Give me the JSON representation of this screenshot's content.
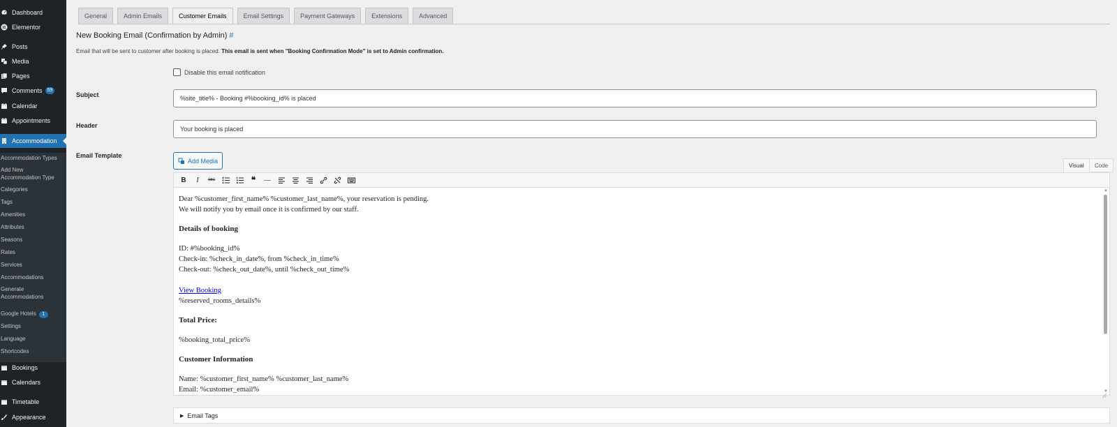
{
  "sidebar": {
    "top_items": [
      {
        "label": "Dashboard",
        "icon": "dashboard-icon"
      },
      {
        "label": "Elementor",
        "icon": "elementor-icon"
      },
      {
        "label": "Posts",
        "icon": "pin-icon"
      },
      {
        "label": "Media",
        "icon": "media-icon"
      },
      {
        "label": "Pages",
        "icon": "pages-icon"
      },
      {
        "label": "Comments",
        "icon": "comment-icon",
        "badge": "59"
      },
      {
        "label": "Calendar",
        "icon": "calendar-icon"
      },
      {
        "label": "Appointments",
        "icon": "calendar-icon"
      },
      {
        "label": "Accommodation",
        "icon": "building-icon",
        "active": true
      }
    ],
    "submenu": [
      "Accommodation Types",
      "Add New Accommodation Type",
      "Categories",
      "Tags",
      "Amenities",
      "Attributes",
      "Seasons",
      "Rates",
      "Services",
      "Accommodations",
      "Generate Accommodations",
      "Google Hotels",
      "Settings",
      "Language",
      "Shortcodes"
    ],
    "google_hotels_badge": "1",
    "bottom_items": [
      {
        "label": "Bookings",
        "icon": "calendar-icon"
      },
      {
        "label": "Calendars",
        "icon": "calendar-icon"
      },
      {
        "label": "Timetable",
        "icon": "calendar-icon"
      },
      {
        "label": "Appearance",
        "icon": "brush-icon"
      }
    ],
    "accent_color": "#2271b1"
  },
  "tabs": [
    "General",
    "Admin Emails",
    "Customer Emails",
    "Email Settings",
    "Payment Gateways",
    "Extensions",
    "Advanced"
  ],
  "active_tab": "Customer Emails",
  "section": {
    "title": "New Booking Email (Confirmation by Admin)",
    "anchor": "#",
    "description_plain": "Email that will be sent to customer after booking is placed. ",
    "description_bold": "This email is sent when \"Booking Confirmation Mode\" is set to Admin confirmation."
  },
  "form": {
    "disable_label": "Disable this email notification",
    "disable_checked": false,
    "subject_label": "Subject",
    "subject_value": "%site_title% - Booking #%booking_id% is placed",
    "header_label": "Header",
    "header_value": "Your booking is placed",
    "template_label": "Email Template",
    "add_media": "Add Media",
    "visual_tab": "Visual",
    "code_tab": "Code"
  },
  "toolbar": {
    "bold": "B",
    "italic": "I",
    "strike": "ABC",
    "blockquote": "❝",
    "hr": "—"
  },
  "editor": {
    "line1": "Dear %customer_first_name% %customer_last_name%, your reservation is pending.",
    "line2": "We will notify you by email once it is confirmed by our staff.",
    "details_heading": "Details of booking",
    "id_line": "ID: #%booking_id%",
    "checkin_line": "Check-in: %check_in_date%, from %check_in_time%",
    "checkout_line": "Check-out: %check_out_date%, until %check_out_time%",
    "view_booking": "View Booking",
    "reserved_rooms": "%reserved_rooms_details%",
    "total_heading": "Total Price:",
    "total_value": "%booking_total_price%",
    "customer_heading": "Customer Information",
    "name_line": "Name: %customer_first_name% %customer_last_name%",
    "email_line": "Email: %customer_email%"
  },
  "email_tags_label": "Email Tags"
}
